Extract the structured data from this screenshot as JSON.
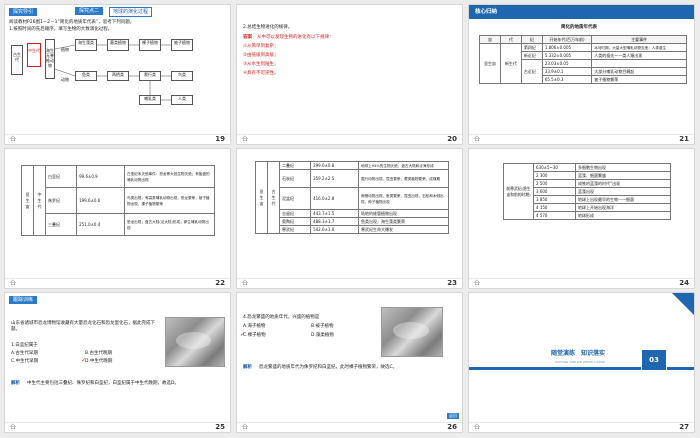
{
  "slides": [
    {
      "number": "19",
      "tab_label": "探究导引",
      "header_tab": "探究点二",
      "header_title": "地球的演化过程",
      "instr1": "阅读教材P26图1－2－1“简化的地质年代表”，思考下列问题。",
      "instr2": "1.按照时间的先后顺序，填写生物的大致演化过程。",
      "labels": {
        "ancient": "古生代",
        "mesozoic": "中生代",
        "algae": "海生藻类",
        "invert": "海生无脊椎动物",
        "fern": "蕨类植物",
        "fish": "鱼类",
        "gymno": "裸子植物",
        "angio": "被子植物",
        "amph": "两栖类",
        "reptile": "爬行类",
        "mammal": "哺乳类",
        "bird": "鸟类",
        "human": "人类",
        "plant_label": "植物",
        "animal_label": "动物"
      }
    },
    {
      "number": "20",
      "q": "2.总结生物进化的规律。",
      "answer_tag": "答案",
      "answer_intro": "从中可以发现生物的进化有以下规律：",
      "items": [
        "①从简单到复杂；",
        "②由低级到高级；",
        "③从水生到陆生；",
        "④具有不可逆性。"
      ]
    },
    {
      "number": "21",
      "header": "核心归纳",
      "table_title": "简化的地质年代表",
      "cols": [
        "宙",
        "代",
        "纪",
        "开始年代(百万年前)",
        "主要事件"
      ],
      "eon": "显生宙",
      "rows": [
        [
          "新生代",
          "第四纪",
          "1.806±0.005",
          "冰河时期，大量大型哺乳动物灭绝；人类诞生"
        ],
        [
          "",
          "新近纪",
          "5.332±0.005",
          "人类的祖先——类人猿出现"
        ],
        [
          "",
          "古近纪",
          "23.03±0.05",
          ""
        ],
        [
          "",
          "",
          "33.9±0.1",
          "大部分哺乳动物目崛起"
        ],
        [
          "",
          "",
          "65.5±0.3",
          "被子植物繁荣"
        ]
      ]
    },
    {
      "number": "22",
      "eon": "显生宙",
      "era": "中生代",
      "rows": [
        [
          "白垩纪",
          "99.6±0.9",
          "白垩纪末灭绝事件：恐龙等大批生物灭绝；有胎盘的哺乳动物出现"
        ],
        [
          "侏罗纪",
          "199.6±0.6",
          "鸟类出现，有袋类哺乳动物出现，恐龙繁荣，被子植物出现，裸子植物繁荣"
        ],
        [
          "三叠纪",
          "251.0±0.4",
          "恐龙出现；盘古大陆(泛大陆)形成；卵生哺乳动物出现"
        ]
      ]
    },
    {
      "number": "23",
      "eon": "显生宙",
      "era": "古生代",
      "rows": [
        [
          "二叠纪",
          "299.0±0.8",
          "地球上95%的生物灭绝，盘古大陆和泛海形成"
        ],
        [
          "石炭纪",
          "359.2±2.5",
          "爬行动物出现，昆虫繁荣，蕨类植物繁荣，成煤期"
        ],
        [
          "泥盆纪",
          "416.0±2.8",
          "两栖动物出现，鱼类繁荣，昆虫出现，石松和木贼出现，种子植物出现"
        ],
        [
          "志留纪",
          "443.7±1.5",
          "陆地的维管植物出现"
        ],
        [
          "奥陶纪",
          "488.3±1.7",
          "鱼类出现，海生藻类繁荣"
        ],
        [
          "寒武纪",
          "542.0±1.0",
          "寒武纪生命大爆发"
        ]
      ]
    },
    {
      "number": "24",
      "era_label": "前寒武纪(隐生宙和前的时期)",
      "rows": [
        [
          "630±5~30",
          "多细胞生物出现"
        ],
        [
          "2 300",
          "蓝藻、细菌繁盛"
        ],
        [
          "2 500",
          "成铁的蓝藻的时代”出现"
        ],
        [
          "3 600",
          "蓝藻出现"
        ],
        [
          "3 850",
          "地球上出现最早的生物——细菌"
        ],
        [
          "4 150",
          "地球上开始出现海洋"
        ],
        [
          "4 570",
          "地球形成"
        ]
      ]
    },
    {
      "number": "25",
      "tab_label": "跟踪训练",
      "stem": "山东省诸城市恐龙博物馆收藏有大量恐龙化石和恐龙蛋化石，据此完成下题。",
      "q": "1.白垩纪属于",
      "options": [
        "A.古生代早期",
        "B.古生代晚期",
        "C.中生代早期",
        "D.中生代晚期"
      ],
      "analysis_tag": "解析",
      "analysis": "中生代主要包括三叠纪、侏罗纪和白垩纪，白垩纪属于中生代晚期，故选D。"
    },
    {
      "number": "26",
      "q": "4.恐龙繁盛的地质年代，兴盛的植物是",
      "options": [
        "A.海子植物",
        "B.被子植物",
        "C.裸子植物",
        "D.藻类植物"
      ],
      "analysis_tag": "解析",
      "analysis": "恐龙繁盛的地质年代为侏罗纪和白垩纪，此时裸子植物繁荣，故选C。",
      "btn": "返回"
    },
    {
      "number": "27",
      "title": "随堂演练　知识落实",
      "subtitle": "SUITANG YANLIAN ZHISHI LUOSHI",
      "badge": "03"
    }
  ],
  "page_mark": "㕣"
}
